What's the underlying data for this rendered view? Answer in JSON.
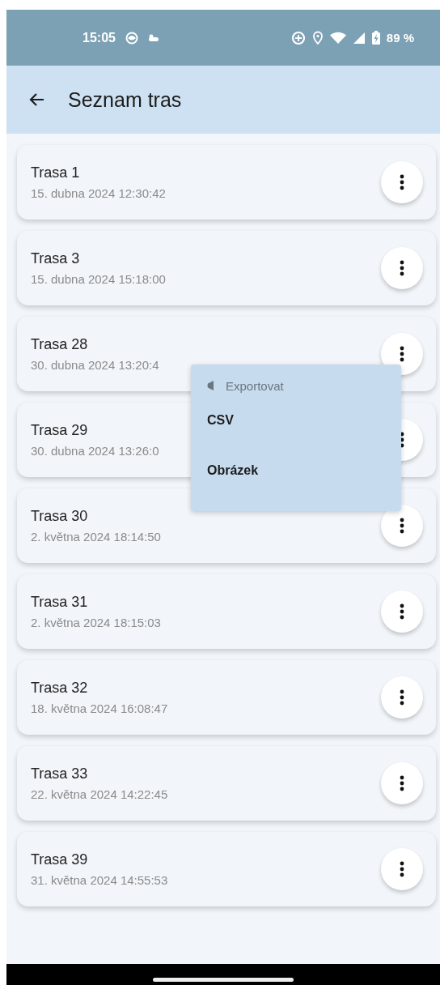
{
  "status_bar": {
    "time": "15:05",
    "battery": "89 %"
  },
  "app_bar": {
    "title": "Seznam tras"
  },
  "routes": [
    {
      "name": "Trasa 1",
      "date": "15. dubna 2024 12:30:42"
    },
    {
      "name": "Trasa 3",
      "date": "15. dubna 2024 15:18:00"
    },
    {
      "name": "Trasa 28",
      "date": "30. dubna 2024 13:20:4"
    },
    {
      "name": "Trasa 29",
      "date": "30. dubna 2024 13:26:0"
    },
    {
      "name": "Trasa 30",
      "date": "2. května 2024 18:14:50"
    },
    {
      "name": "Trasa 31",
      "date": "2. května 2024 18:15:03"
    },
    {
      "name": "Trasa 32",
      "date": "18. května 2024 16:08:47"
    },
    {
      "name": "Trasa 33",
      "date": "22. května 2024 14:22:45"
    },
    {
      "name": "Trasa 39",
      "date": "31. května 2024 14:55:53"
    }
  ],
  "context_menu": {
    "title": "Exportovat",
    "items": [
      {
        "label": "CSV"
      },
      {
        "label": "Obrázek"
      }
    ]
  }
}
